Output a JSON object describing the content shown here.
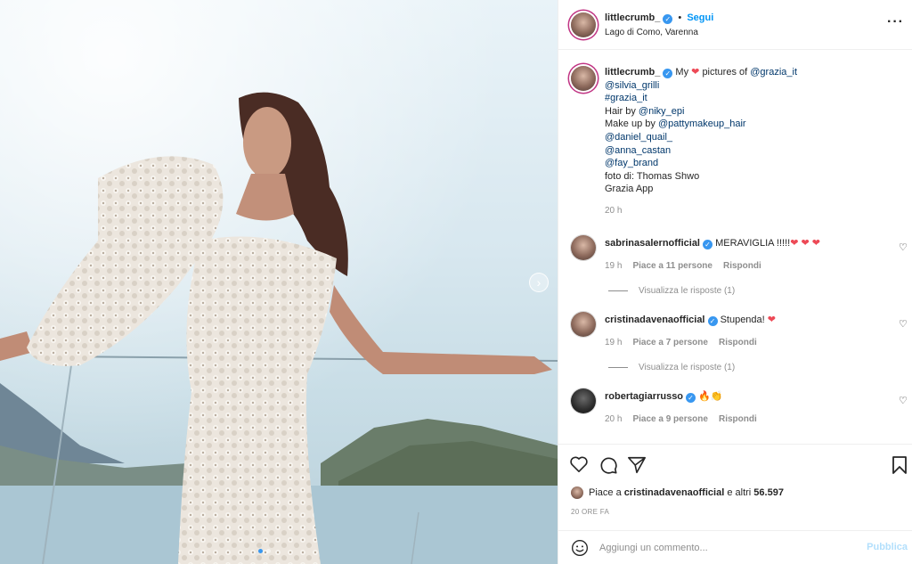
{
  "post": {
    "username": "littlecrumb_",
    "follow_label": "Segui",
    "location": "Lago di Como, Varenna",
    "more_icon": "more-horizontal-icon"
  },
  "caption": {
    "username": "littlecrumb_",
    "text_my": "My",
    "text_pictures": "pictures of",
    "mention_grazia": "@grazia_it",
    "mention_silvia": "@silvia_grilli",
    "hashtag": "#grazia_it",
    "hair_label": "Hair by",
    "hair_mention": "@niky_epi",
    "makeup_label": "Make up by",
    "makeup_mention": "@pattymakeup_hair",
    "mention_daniel": "@daniel_quail_",
    "mention_anna": "@anna_castan",
    "mention_fay": "@fay_brand",
    "photo_credit": "foto di: Thomas Shwo",
    "app": "Grazia App",
    "time": "20 h"
  },
  "comments": [
    {
      "username": "sabrinasalernofficial",
      "text": "MERAVIGLIA !!!!!",
      "time": "19 h",
      "likes": "Piace a 11 persone",
      "reply": "Rispondi",
      "view_replies": "Visualizza le risposte (1)"
    },
    {
      "username": "cristinadavenaofficial",
      "text": "Stupenda!",
      "time": "19 h",
      "likes": "Piace a 7 persone",
      "reply": "Rispondi",
      "view_replies": "Visualizza le risposte (1)"
    },
    {
      "username": "robertagiarrusso",
      "text": "🔥👏",
      "time": "20 h",
      "likes": "Piace a 9 persone",
      "reply": "Rispondi"
    }
  ],
  "likes_line": {
    "prefix": "Piace a",
    "user": "cristinadavenaofficial",
    "suffix": "e altri",
    "count": "56.597"
  },
  "time_ago": "20 ORE FA",
  "add_comment": {
    "placeholder": "Aggiungi un commento...",
    "post_label": "Pubblica"
  },
  "colors": {
    "accent": "#0095f6",
    "heart": "#ed4956",
    "muted": "#8e8e8e"
  }
}
